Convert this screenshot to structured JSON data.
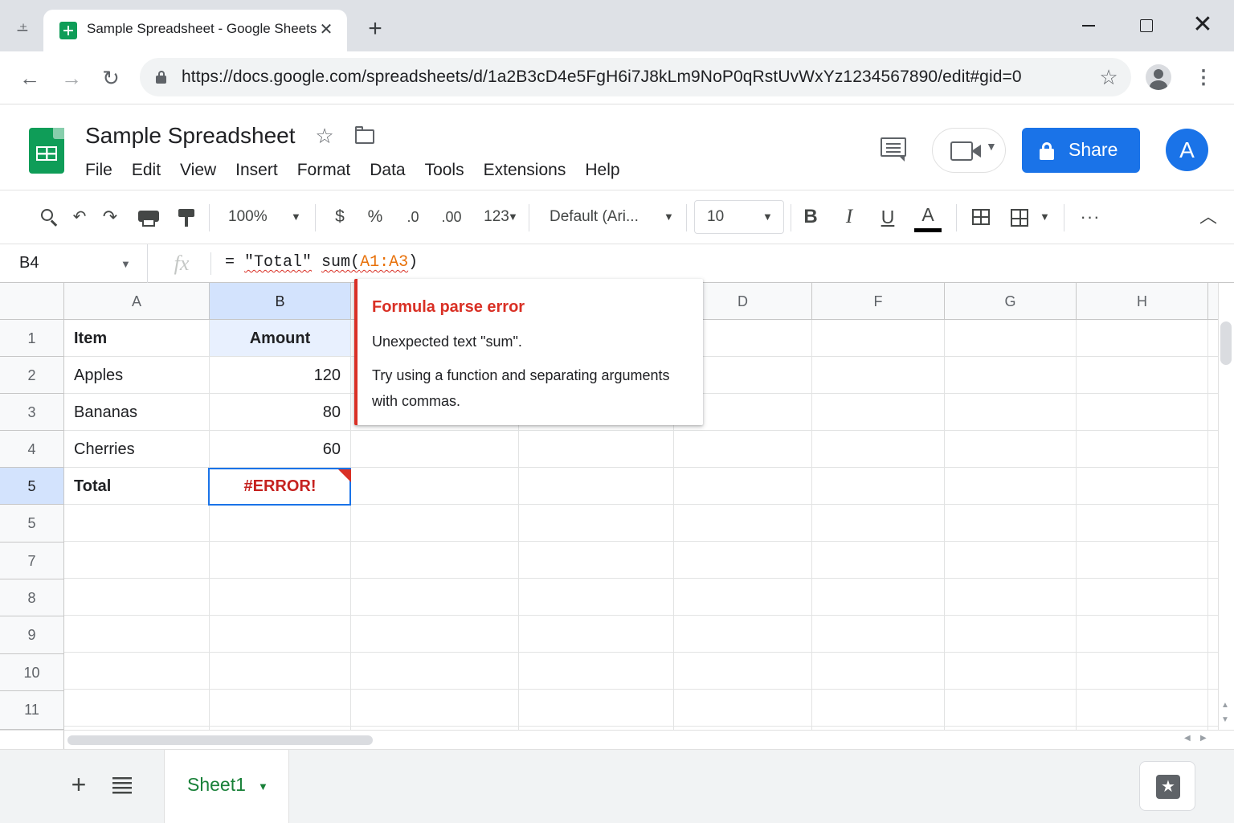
{
  "browser": {
    "tab_title": "Sample Spreadsheet - Google Sheets",
    "tab_close": "✕",
    "new_tab": "+",
    "url": "https://docs.google.com/spreadsheets/d/1a2B3cD4e5FgH6i7J8kLm9NoP0qRstUvWxYz1234567890/edit#gid=0",
    "win_close": "✕"
  },
  "app": {
    "title": "Sample Spreadsheet",
    "menu": [
      "File",
      "Edit",
      "View",
      "Insert",
      "Format",
      "Data",
      "Tools",
      "Extensions",
      "Help"
    ],
    "share_label": "Share",
    "avatar_letter": "A",
    "accent_color": "#1a73e8",
    "brand_color": "#0f9d58"
  },
  "toolbar": {
    "zoom": "100%",
    "currency": "$",
    "percent": "%",
    "decrease_decimal": ".0",
    "increase_decimal": ".00",
    "number_format": "123",
    "font": "Default (Ari...",
    "font_size": "10",
    "bold": "B",
    "italic": "I",
    "underline": "U",
    "text_color": "A",
    "more": "···"
  },
  "formula_bar": {
    "cell_ref": "B4",
    "fx": "fx",
    "eq": "= ",
    "str": "\"Total\"",
    "space": " ",
    "fn": "sum(",
    "range": "A1:A3",
    "close": ")"
  },
  "grid": {
    "columns": [
      "A",
      "B",
      "",
      "D",
      "F",
      "G",
      "H"
    ],
    "row_numbers": [
      "1",
      "2",
      "3",
      "4",
      "5",
      "5",
      "7",
      "8",
      "9",
      "10",
      "11"
    ],
    "rows": [
      [
        "Item",
        "Amount"
      ],
      [
        "Apples",
        "120"
      ],
      [
        "Bananas",
        "80"
      ],
      [
        "Cherries",
        "60"
      ],
      [
        "Total",
        "#ERROR!"
      ]
    ]
  },
  "error_tooltip": {
    "title": "Formula parse error",
    "line1": "Unexpected text \"sum\".",
    "line2": "Try using a function and separating arguments with commas.",
    "color": "#d93025"
  },
  "sheets": {
    "add": "+",
    "active_tab": "Sheet1"
  }
}
